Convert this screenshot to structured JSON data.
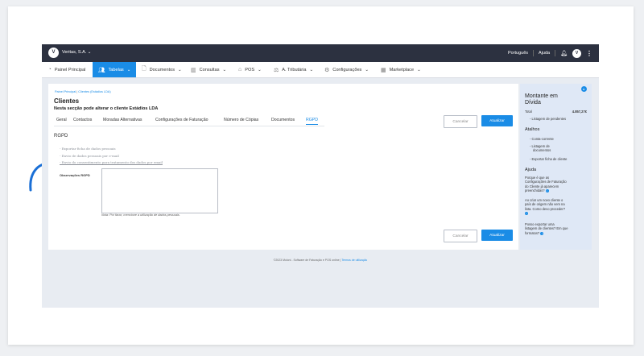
{
  "topbar": {
    "logo_text": "V",
    "company": "Veritas, S.A.",
    "language": "Português",
    "help": "Ajuda",
    "avatar_text": "V"
  },
  "nav": {
    "items": [
      {
        "label": "Painel Principal",
        "icon": "dashboard-icon"
      },
      {
        "label": "Tabelas",
        "icon": "users-icon"
      },
      {
        "label": "Documentos",
        "icon": "document-icon"
      },
      {
        "label": "Consultas",
        "icon": "chart-icon"
      },
      {
        "label": "POS",
        "icon": "pos-icon"
      },
      {
        "label": "A. Tributária",
        "icon": "tax-icon"
      },
      {
        "label": "Configurações",
        "icon": "settings-icon"
      },
      {
        "label": "Marketplace",
        "icon": "marketplace-icon"
      }
    ],
    "active_index": 1
  },
  "page": {
    "breadcrumb_root": "Painel Principal",
    "breadcrumb_sep": "|",
    "breadcrumb_current": "Clientes (Estádios LDA)",
    "title": "Clientes",
    "subtitle": "Nesta secção pode alterar o cliente Estádios LDA",
    "tabs": [
      "Geral",
      "Contactos",
      "Moradas Alternativas",
      "Configurações de Faturação",
      "Número de Cópias",
      "Documentos",
      "RGPD"
    ],
    "active_tab": "RGPD",
    "cancel_label": "Cancelar",
    "update_label": "Atualizar",
    "section_title": "RGPD",
    "links": [
      "- Exportar ficha de dados pessoais",
      "- Envio de dados pessoais por e-mail",
      "- Envio do consentimento para tratamento dos dados por email"
    ],
    "obs_label": "Observações RGPD",
    "obs_value": "",
    "obs_note": "Nota: Por favor, mencione a utilização de dados pessoais."
  },
  "sidebar": {
    "amount_title_1": "Montante em",
    "amount_title_2": "Dívida",
    "total_label": "Total",
    "total_value": "4.857,27€",
    "pending_link": "- Listagem de pendentes",
    "shortcuts_title": "Atalhos",
    "shortcuts": [
      "- Conta-corrente",
      "- Listagem de",
      "documentos",
      "- Exportar ficha de cliente"
    ],
    "help_title": "Ajuda",
    "help_items": [
      [
        "Porque é que as",
        "Configurações de Faturação",
        "do Cliente já aparecem",
        "preenchidas?"
      ],
      [
        "Ao criar um novo cliente o",
        "país de origem não vem na",
        "lista. Como devo proceder?"
      ],
      [
        "Posso exportar uma",
        "listagem de clientes? Em que",
        "formatos?"
      ]
    ]
  },
  "footer": {
    "text": "©2023 Moloni - Software de Faturação e POS online |",
    "link": "Termos de utilização"
  },
  "colors": {
    "accent": "#1a8ce6",
    "topbar": "#2c3140",
    "sidebar": "#dfe8f6"
  }
}
